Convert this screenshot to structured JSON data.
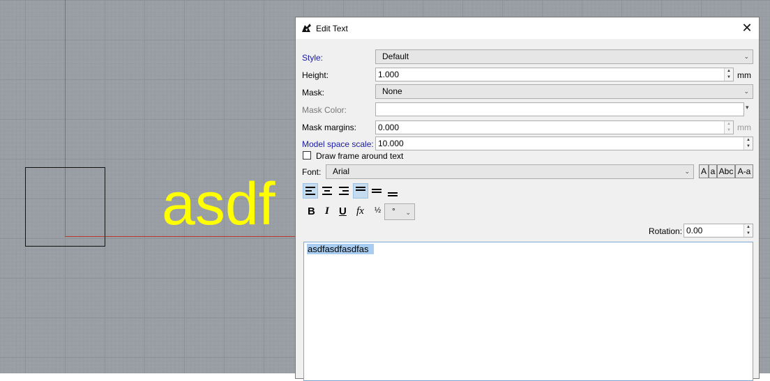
{
  "viewport": {
    "text_entity": "asdf"
  },
  "dialog": {
    "title": "Edit Text",
    "style": {
      "label": "Style:",
      "value": "Default"
    },
    "height": {
      "label": "Height:",
      "value": "1.000",
      "unit": "mm"
    },
    "mask": {
      "label": "Mask:",
      "value": "None"
    },
    "mask_color": {
      "label": "Mask Color:",
      "value": ""
    },
    "mask_margins": {
      "label": "Mask margins:",
      "value": "0.000",
      "unit": "mm"
    },
    "model_space_scale": {
      "label": "Model space scale:",
      "value": "10.000"
    },
    "draw_frame": {
      "label": "Draw frame around text",
      "checked": false
    },
    "font": {
      "label": "Font:",
      "value": "Arial"
    },
    "case_buttons": [
      "A",
      "a",
      "Abc",
      "A-a"
    ],
    "format_buttons": {
      "bold": "B",
      "italic": "I",
      "underline": "U",
      "fx": "fx",
      "fraction": "½",
      "symbol": "°"
    },
    "rotation": {
      "label": "Rotation:",
      "value": "0.00"
    },
    "text_content": "asdfasdfasdfas"
  },
  "colors": {
    "text_entity": "#ffff00",
    "link_label": "#1a1aa6",
    "selection": "#a8cdf0"
  }
}
